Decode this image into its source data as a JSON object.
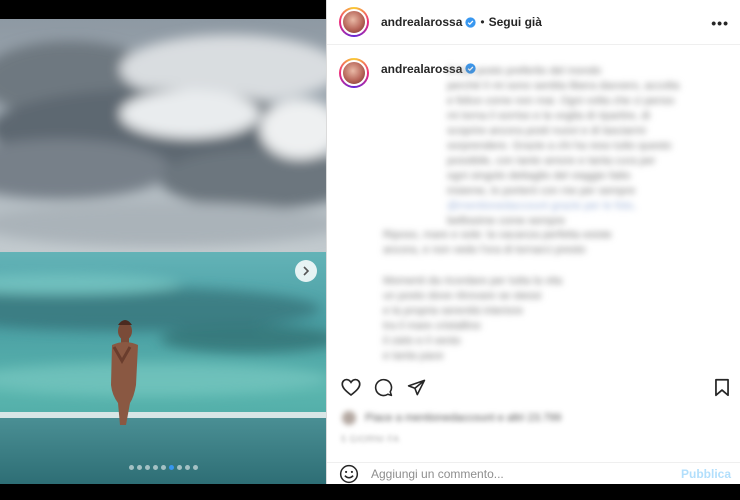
{
  "post": {
    "username": "andrealarossa",
    "separator": "•",
    "follow_label": "Segui già",
    "more_label": "•••",
    "carousel": {
      "dot_count": 9,
      "active_index": 5
    }
  },
  "caption": {
    "username": "andrealarossa",
    "lines": [
      "Il mio posto preferito del mondo",
      "perché lì mi sono sentita libera davvero, accolta",
      "e felice come non mai. Ogni volta che ci penso",
      "mi torna il sorriso e la voglia di ripartire, di",
      "scoprire ancora posti nuovi e di lasciarmi",
      "sorprendere. Grazie a chi ha reso tutto questo",
      "possibile, con tanto amore e tanta cura per",
      "ogni singolo dettaglio del viaggio fatto",
      "insieme, lo porterò con me per sempre",
      "@mentionedaccount grazie per le foto,",
      "bellissime come sempre"
    ],
    "lines2": [
      "Riposo, mare e sole: la vacanza perfetta esiste",
      "ancora, e non vedo l'ora di tornarci presto"
    ],
    "lines3": [
      "Momenti da ricordare per tutta la vita",
      "un posto dove ritrovare se stessi",
      "e la propria serenità interiore",
      "tra il mare cristallino",
      "il cielo e il vento",
      "e tanta pace"
    ]
  },
  "likes": {
    "text": "Piace a mentionedaccount e altri 23.799"
  },
  "date": "5 GIORNI FA",
  "comment": {
    "placeholder": "Aggiungi un commento...",
    "publish_label": "Pubblica"
  },
  "colors": {
    "link_blue": "#0095f6",
    "publish_disabled": "#b2dffc",
    "verified_blue": "#3897f0"
  }
}
